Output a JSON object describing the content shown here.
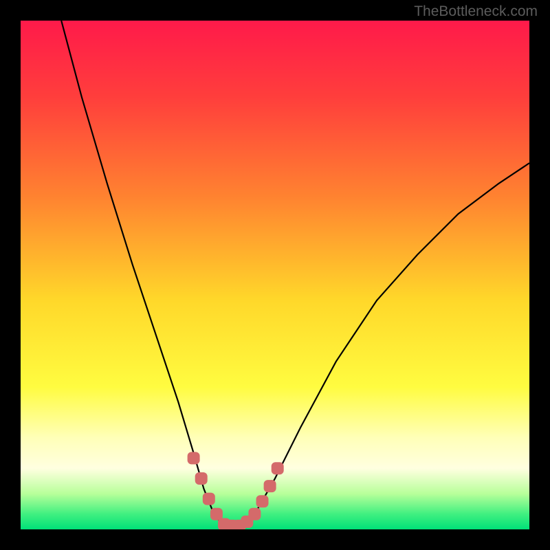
{
  "watermark": "TheBottleneck.com",
  "chart_data": {
    "type": "line",
    "title": "",
    "xlabel": "",
    "ylabel": "",
    "xlim": [
      0,
      100
    ],
    "ylim": [
      0,
      100
    ],
    "gradient_stops": [
      {
        "offset": 0.0,
        "color": "#ff1a4a"
      },
      {
        "offset": 0.15,
        "color": "#ff3e3c"
      },
      {
        "offset": 0.35,
        "color": "#ff8430"
      },
      {
        "offset": 0.55,
        "color": "#ffd82a"
      },
      {
        "offset": 0.72,
        "color": "#fffc40"
      },
      {
        "offset": 0.82,
        "color": "#ffffb8"
      },
      {
        "offset": 0.88,
        "color": "#ffffe0"
      },
      {
        "offset": 0.93,
        "color": "#b8ff9a"
      },
      {
        "offset": 0.97,
        "color": "#40f080"
      },
      {
        "offset": 1.0,
        "color": "#00e078"
      }
    ],
    "series": [
      {
        "name": "v-curve",
        "type": "line",
        "stroke": "#000000",
        "points": [
          {
            "x": 8,
            "y": 100
          },
          {
            "x": 12,
            "y": 85
          },
          {
            "x": 17,
            "y": 68
          },
          {
            "x": 22,
            "y": 52
          },
          {
            "x": 27,
            "y": 37
          },
          {
            "x": 31,
            "y": 25
          },
          {
            "x": 34,
            "y": 15
          },
          {
            "x": 36,
            "y": 8
          },
          {
            "x": 38,
            "y": 3
          },
          {
            "x": 40,
            "y": 0.5
          },
          {
            "x": 43,
            "y": 0.5
          },
          {
            "x": 46,
            "y": 3
          },
          {
            "x": 50,
            "y": 10
          },
          {
            "x": 55,
            "y": 20
          },
          {
            "x": 62,
            "y": 33
          },
          {
            "x": 70,
            "y": 45
          },
          {
            "x": 78,
            "y": 54
          },
          {
            "x": 86,
            "y": 62
          },
          {
            "x": 94,
            "y": 68
          },
          {
            "x": 100,
            "y": 72
          }
        ]
      },
      {
        "name": "bottom-markers",
        "type": "scatter",
        "stroke": "#d46a6a",
        "points": [
          {
            "x": 34,
            "y": 14
          },
          {
            "x": 35.5,
            "y": 10
          },
          {
            "x": 37,
            "y": 6
          },
          {
            "x": 38.5,
            "y": 3
          },
          {
            "x": 40,
            "y": 1
          },
          {
            "x": 41.5,
            "y": 0.7
          },
          {
            "x": 43,
            "y": 0.7
          },
          {
            "x": 44.5,
            "y": 1.5
          },
          {
            "x": 46,
            "y": 3
          },
          {
            "x": 47.5,
            "y": 5.5
          },
          {
            "x": 49,
            "y": 8.5
          },
          {
            "x": 50.5,
            "y": 12
          }
        ]
      }
    ]
  }
}
